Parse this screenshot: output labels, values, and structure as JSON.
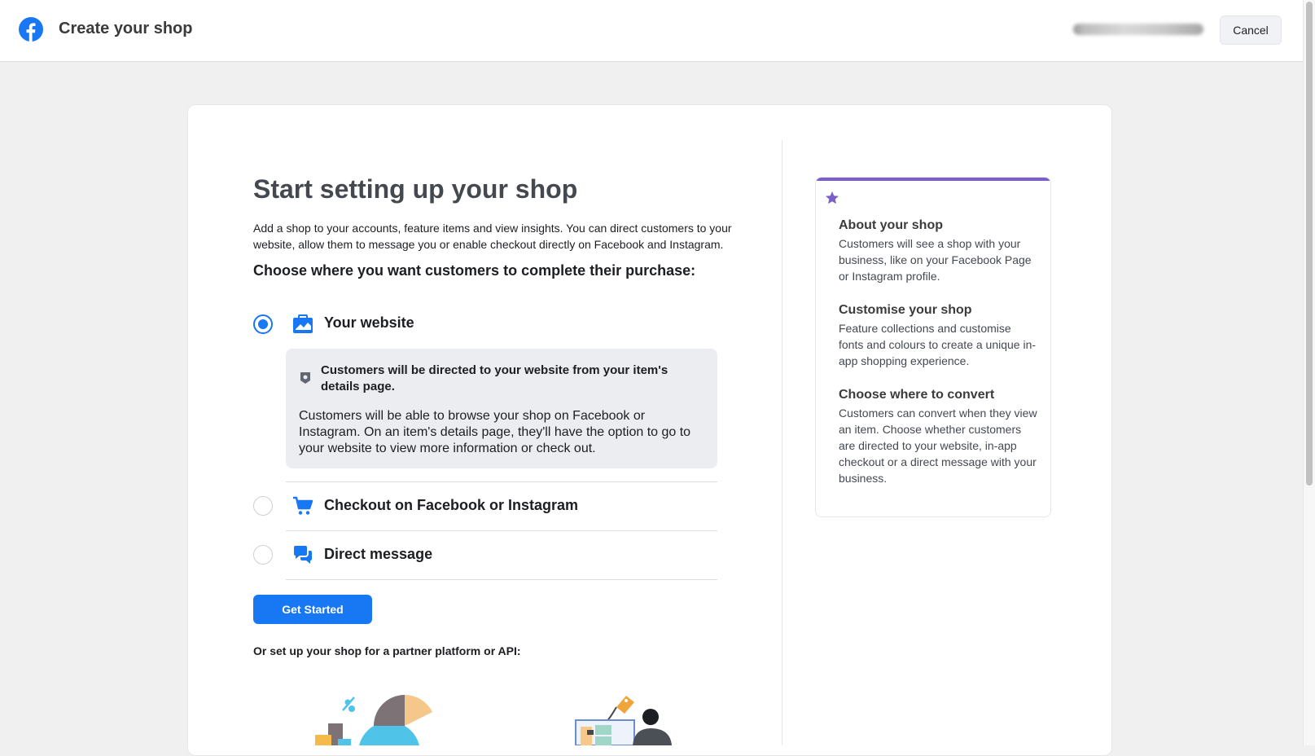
{
  "header": {
    "title": "Create your shop",
    "cancel_label": "Cancel",
    "logo_icon": "facebook-logo-icon"
  },
  "main": {
    "heading": "Start setting up your shop",
    "intro": "Add a shop to your accounts, feature items and view insights. You can direct customers to your website, allow them to message you or enable checkout directly on Facebook and Instagram.",
    "choose_label": "Choose where you want customers to complete their purchase:",
    "options": [
      {
        "label": "Your website",
        "icon": "website-icon",
        "selected": true
      },
      {
        "label": "Checkout on Facebook or Instagram",
        "icon": "cart-icon",
        "selected": false
      },
      {
        "label": "Direct message",
        "icon": "message-icon",
        "selected": false
      }
    ],
    "info_box": {
      "title": "Customers will be directed to your website from your item's details page.",
      "text": "Customers will be able to browse your shop on Facebook or Instagram. On an item's details page, they'll have the option to go to your website to view more information or check out."
    },
    "primary_button": "Get Started",
    "partner_text": "Or set up your shop for a partner platform or API:"
  },
  "side_panel": {
    "accent_color": "#7b5fc4",
    "sections": [
      {
        "title": "About your shop",
        "text": "Customers will see a shop with your business, like on your Facebook Page or Instagram profile."
      },
      {
        "title": "Customise your shop",
        "text": "Feature collections and customise fonts and colours to create a unique in-app shopping experience."
      },
      {
        "title": "Choose where to convert",
        "text": "Customers can convert when they view an item. Choose whether customers are directed to your website, in-app checkout or a direct message with your business."
      }
    ]
  },
  "colors": {
    "brand_blue": "#1877f2",
    "heading_gray": "#444950"
  }
}
